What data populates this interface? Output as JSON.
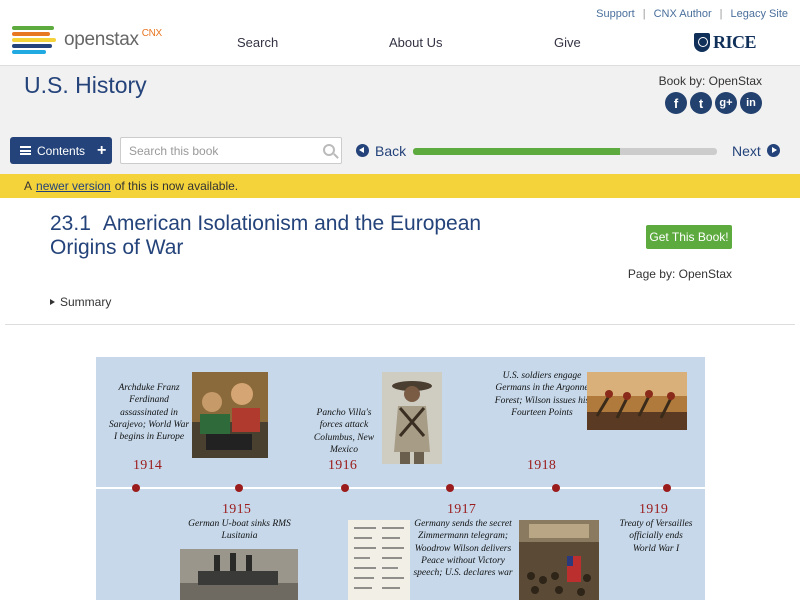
{
  "utility": {
    "support": "Support",
    "cnx_author": "CNX Author",
    "legacy_site": "Legacy Site"
  },
  "brand": {
    "name": "openstax",
    "suffix": "CNX",
    "stripe_colors": [
      "#5daa3f",
      "#e87722",
      "#f3d23a",
      "#24437a",
      "#21a9e1"
    ]
  },
  "nav": {
    "search": "Search",
    "about": "About Us",
    "give": "Give",
    "partner": "RICE"
  },
  "book": {
    "title": "U.S. History",
    "by": "Book by: OpenStax",
    "social": [
      "f",
      "t",
      "g+",
      "in"
    ]
  },
  "toolbar": {
    "contents": "Contents",
    "search_placeholder": "Search this book",
    "back": "Back",
    "next": "Next",
    "progress_percent": 68
  },
  "notice": {
    "prefix": "A",
    "link": "newer version",
    "suffix": "of this is now available."
  },
  "section": {
    "number": "23.1",
    "title": "American Isolationism and the European Origins of War",
    "get_book": "Get This Book!",
    "page_by": "Page by: OpenStax",
    "summary": "Summary"
  },
  "timeline": {
    "events": [
      {
        "year": "1914",
        "text": "Archduke Franz Ferdinand assassinated in Sarajevo; World War I begins in Europe"
      },
      {
        "year": "1915",
        "text": "German U-boat sinks RMS Lusitania"
      },
      {
        "year": "1916",
        "text": "Pancho Villa's forces attack Columbus, New Mexico"
      },
      {
        "year": "1917",
        "text": "Germany sends the secret Zimmermann telegram; Woodrow Wilson delivers Peace without Victory speech; U.S. declares war"
      },
      {
        "year": "1918",
        "text": "U.S. soldiers engage Germans in the Argonne Forest; Wilson issues his Fourteen Points"
      },
      {
        "year": "1919",
        "text": "Treaty of Versailles officially ends World War I"
      }
    ]
  }
}
